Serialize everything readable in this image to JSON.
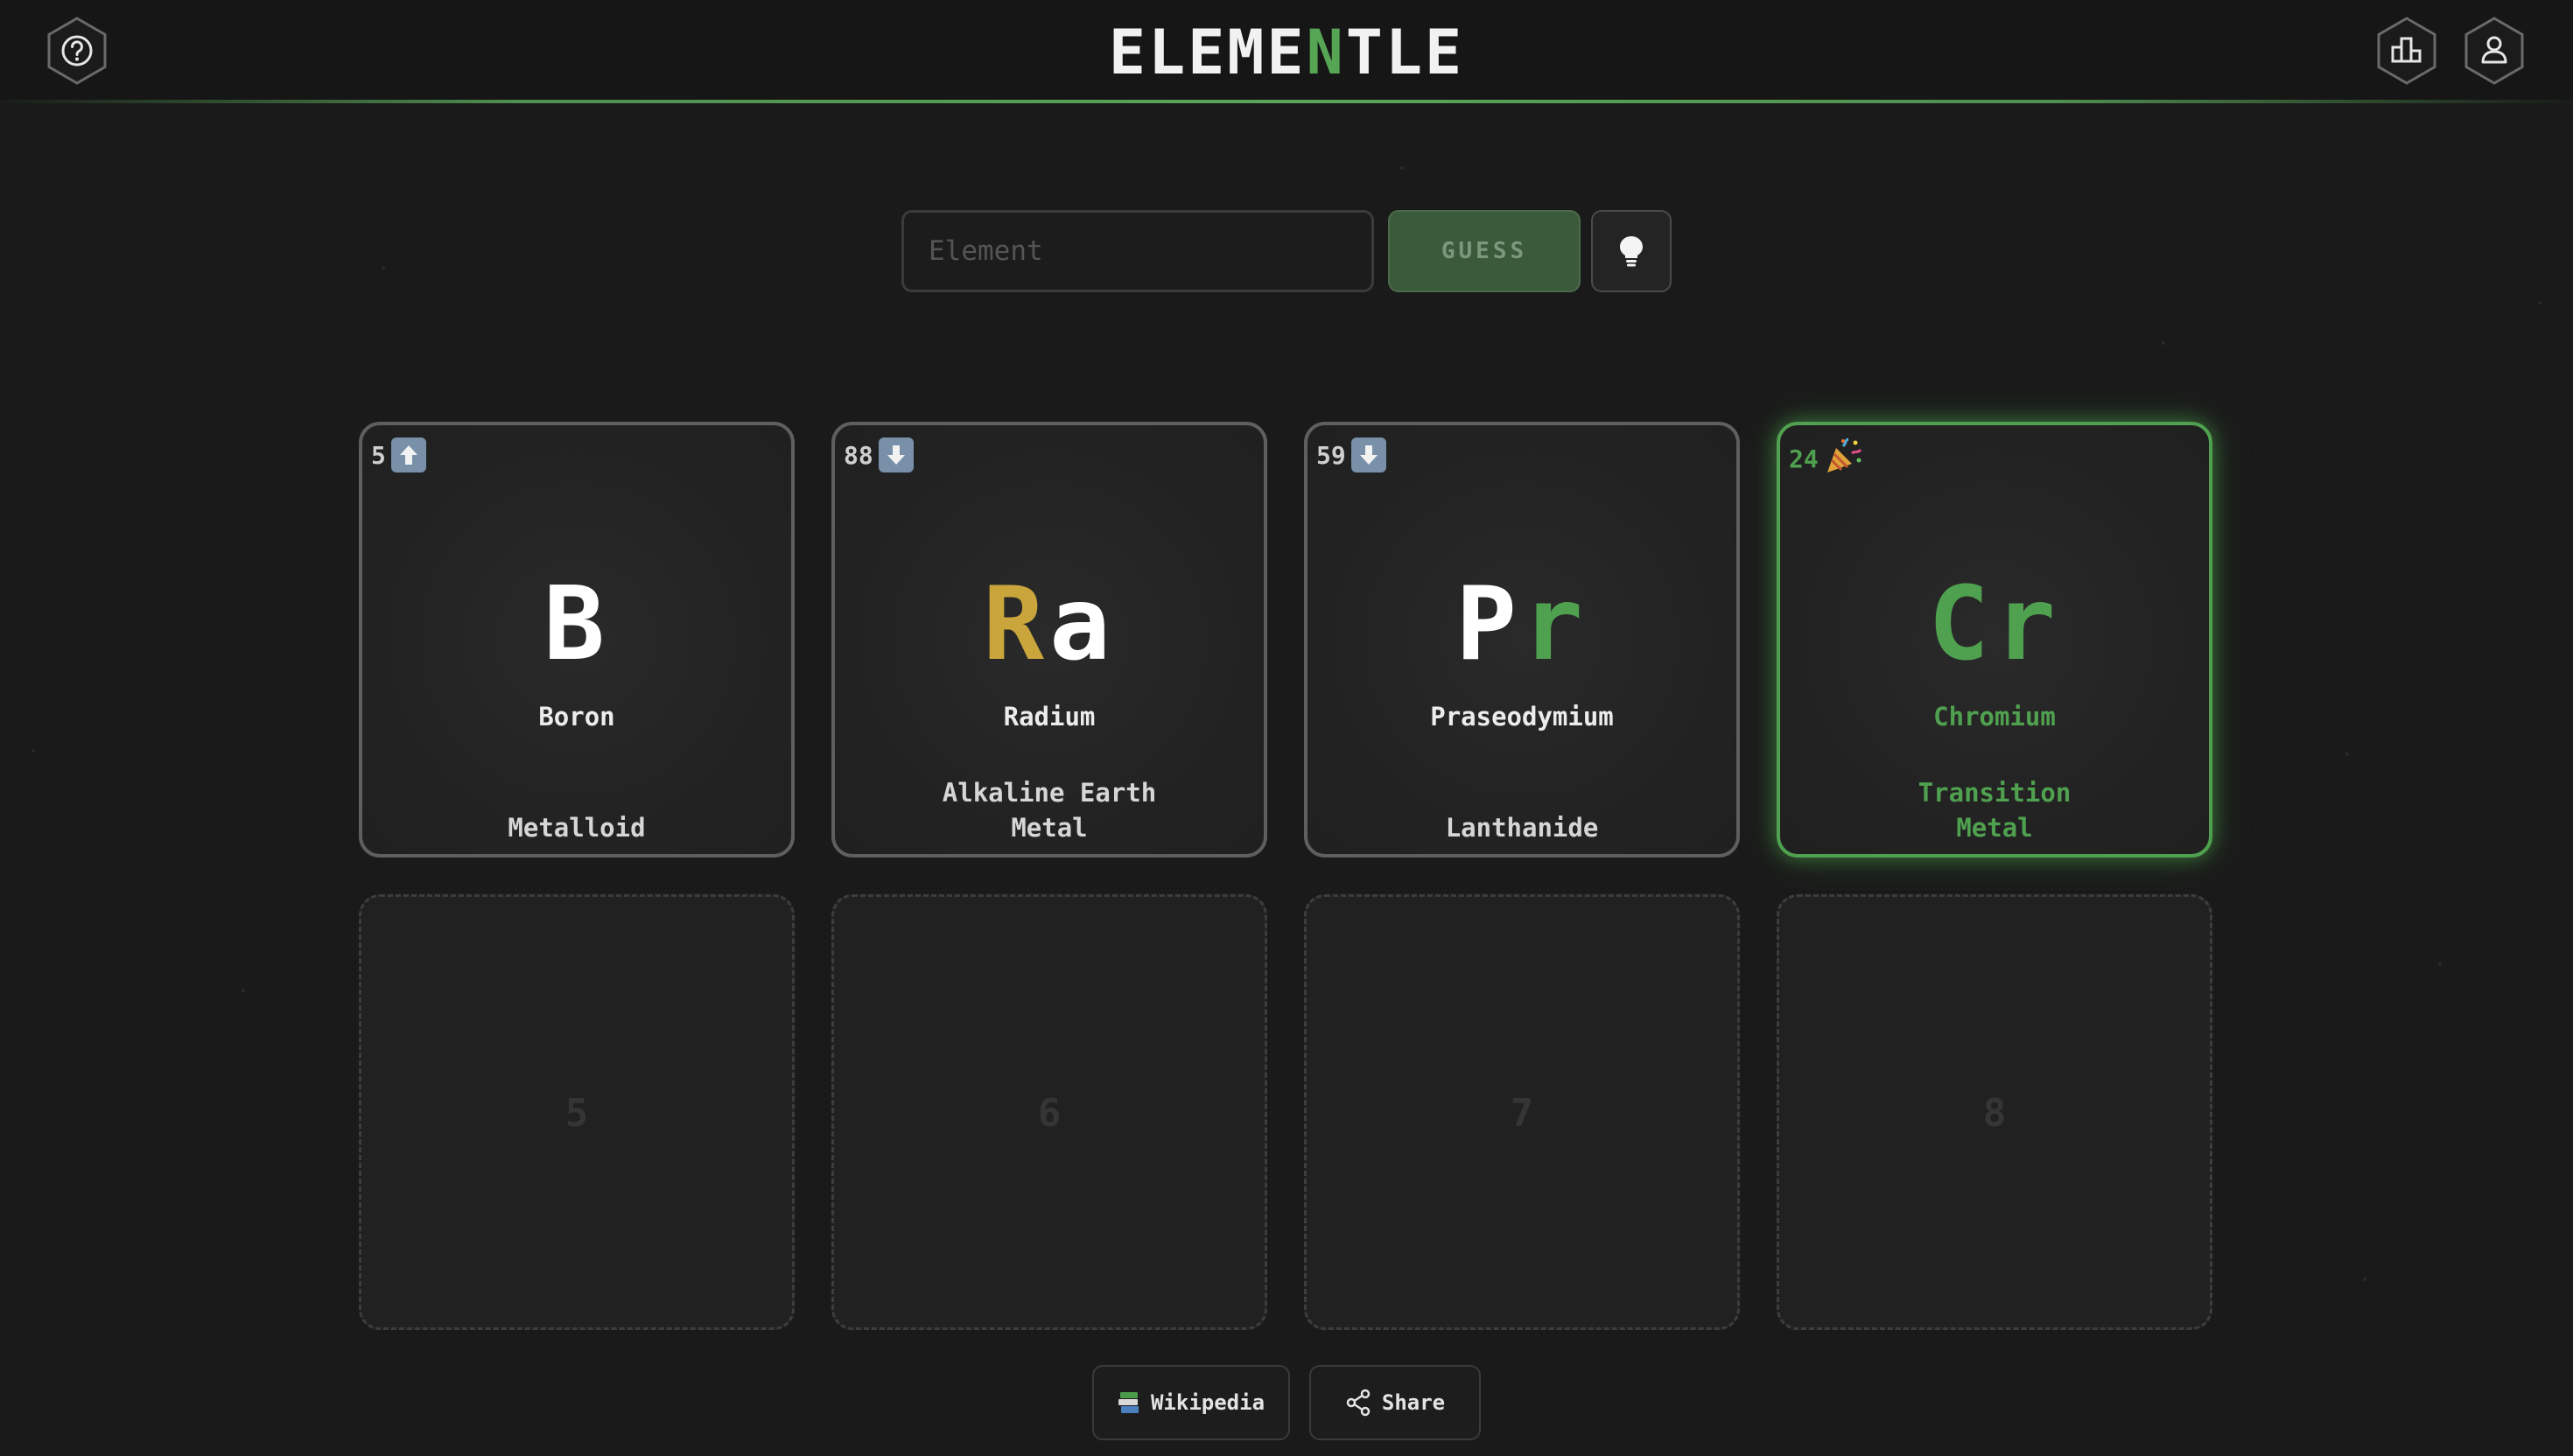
{
  "header": {
    "title_pre": "ELEME",
    "title_accent": "N",
    "title_post": "TLE",
    "help_icon": "question-circle-icon",
    "stats_icon": "bar-chart-icon",
    "profile_icon": "user-icon",
    "accent_color": "#55a555"
  },
  "guess": {
    "placeholder": "Element",
    "value": "",
    "button_label": "GUESS",
    "hint_icon": "lightbulb-icon"
  },
  "guesses": [
    {
      "number": "5",
      "direction": "up",
      "symbol_parts": [
        {
          "text": "B",
          "tone": "white"
        }
      ],
      "name": "Boron",
      "category": "Metalloid",
      "correct": false
    },
    {
      "number": "88",
      "direction": "down",
      "symbol_parts": [
        {
          "text": "R",
          "tone": "gold"
        },
        {
          "text": "a",
          "tone": "white"
        }
      ],
      "name": "Radium",
      "category_line1": "Alkaline Earth",
      "category_line2": "Metal",
      "correct": false
    },
    {
      "number": "59",
      "direction": "down",
      "symbol_parts": [
        {
          "text": "P",
          "tone": "white"
        },
        {
          "text": "r",
          "tone": "green"
        }
      ],
      "name": "Praseodymium",
      "category": "Lanthanide",
      "correct": false
    },
    {
      "number": "24",
      "direction": "party",
      "symbol_parts": [
        {
          "text": "Cr",
          "tone": "green"
        }
      ],
      "name": "Chromium",
      "category_line1": "Transition",
      "category_line2": "Metal",
      "correct": true
    }
  ],
  "empty_slots": [
    "5",
    "6",
    "7",
    "8"
  ],
  "footer": {
    "wikipedia_label": "Wikipedia",
    "wikipedia_icon": "books-icon",
    "share_label": "Share",
    "share_icon": "share-icon"
  },
  "colors": {
    "correct": "#4fa14f",
    "partial": "#c9a53c",
    "arrow_badge": "#7891a8"
  }
}
